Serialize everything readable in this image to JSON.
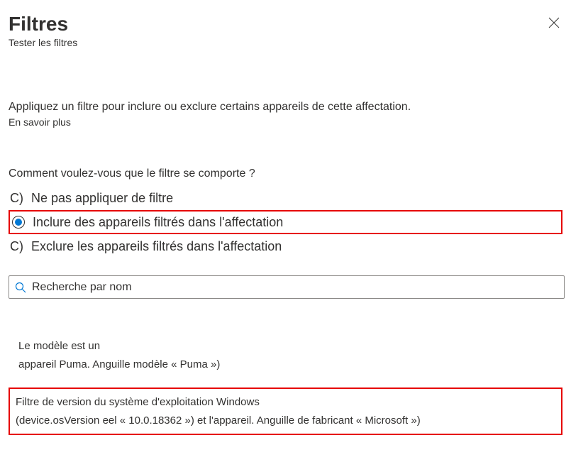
{
  "header": {
    "title": "Filtres",
    "subtitle": "Tester les filtres"
  },
  "description": "Appliquez un filtre pour inclure ou exclure certains appareils de cette affectation.",
  "learn_more": "En savoir plus",
  "question": "Comment voulez-vous que le filtre se comporte ?",
  "options": {
    "none": {
      "marker": "C)",
      "label": "Ne pas appliquer de filtre"
    },
    "include": {
      "label": "Inclure des appareils filtrés dans l'affectation"
    },
    "exclude": {
      "marker": "C)",
      "label": "Exclure les appareils filtrés dans l'affectation"
    }
  },
  "search": {
    "placeholder": "Recherche par nom"
  },
  "filters": {
    "model": {
      "line1": "Le modèle est un",
      "line2": "appareil Puma. Anguille modèle « Puma »)"
    },
    "osversion": {
      "line1": "Filtre de version du système d'exploitation Windows",
      "line2": "(device.osVersion eel « 10.0.18362 ») et l'appareil. Anguille de fabricant « Microsoft »)"
    }
  }
}
